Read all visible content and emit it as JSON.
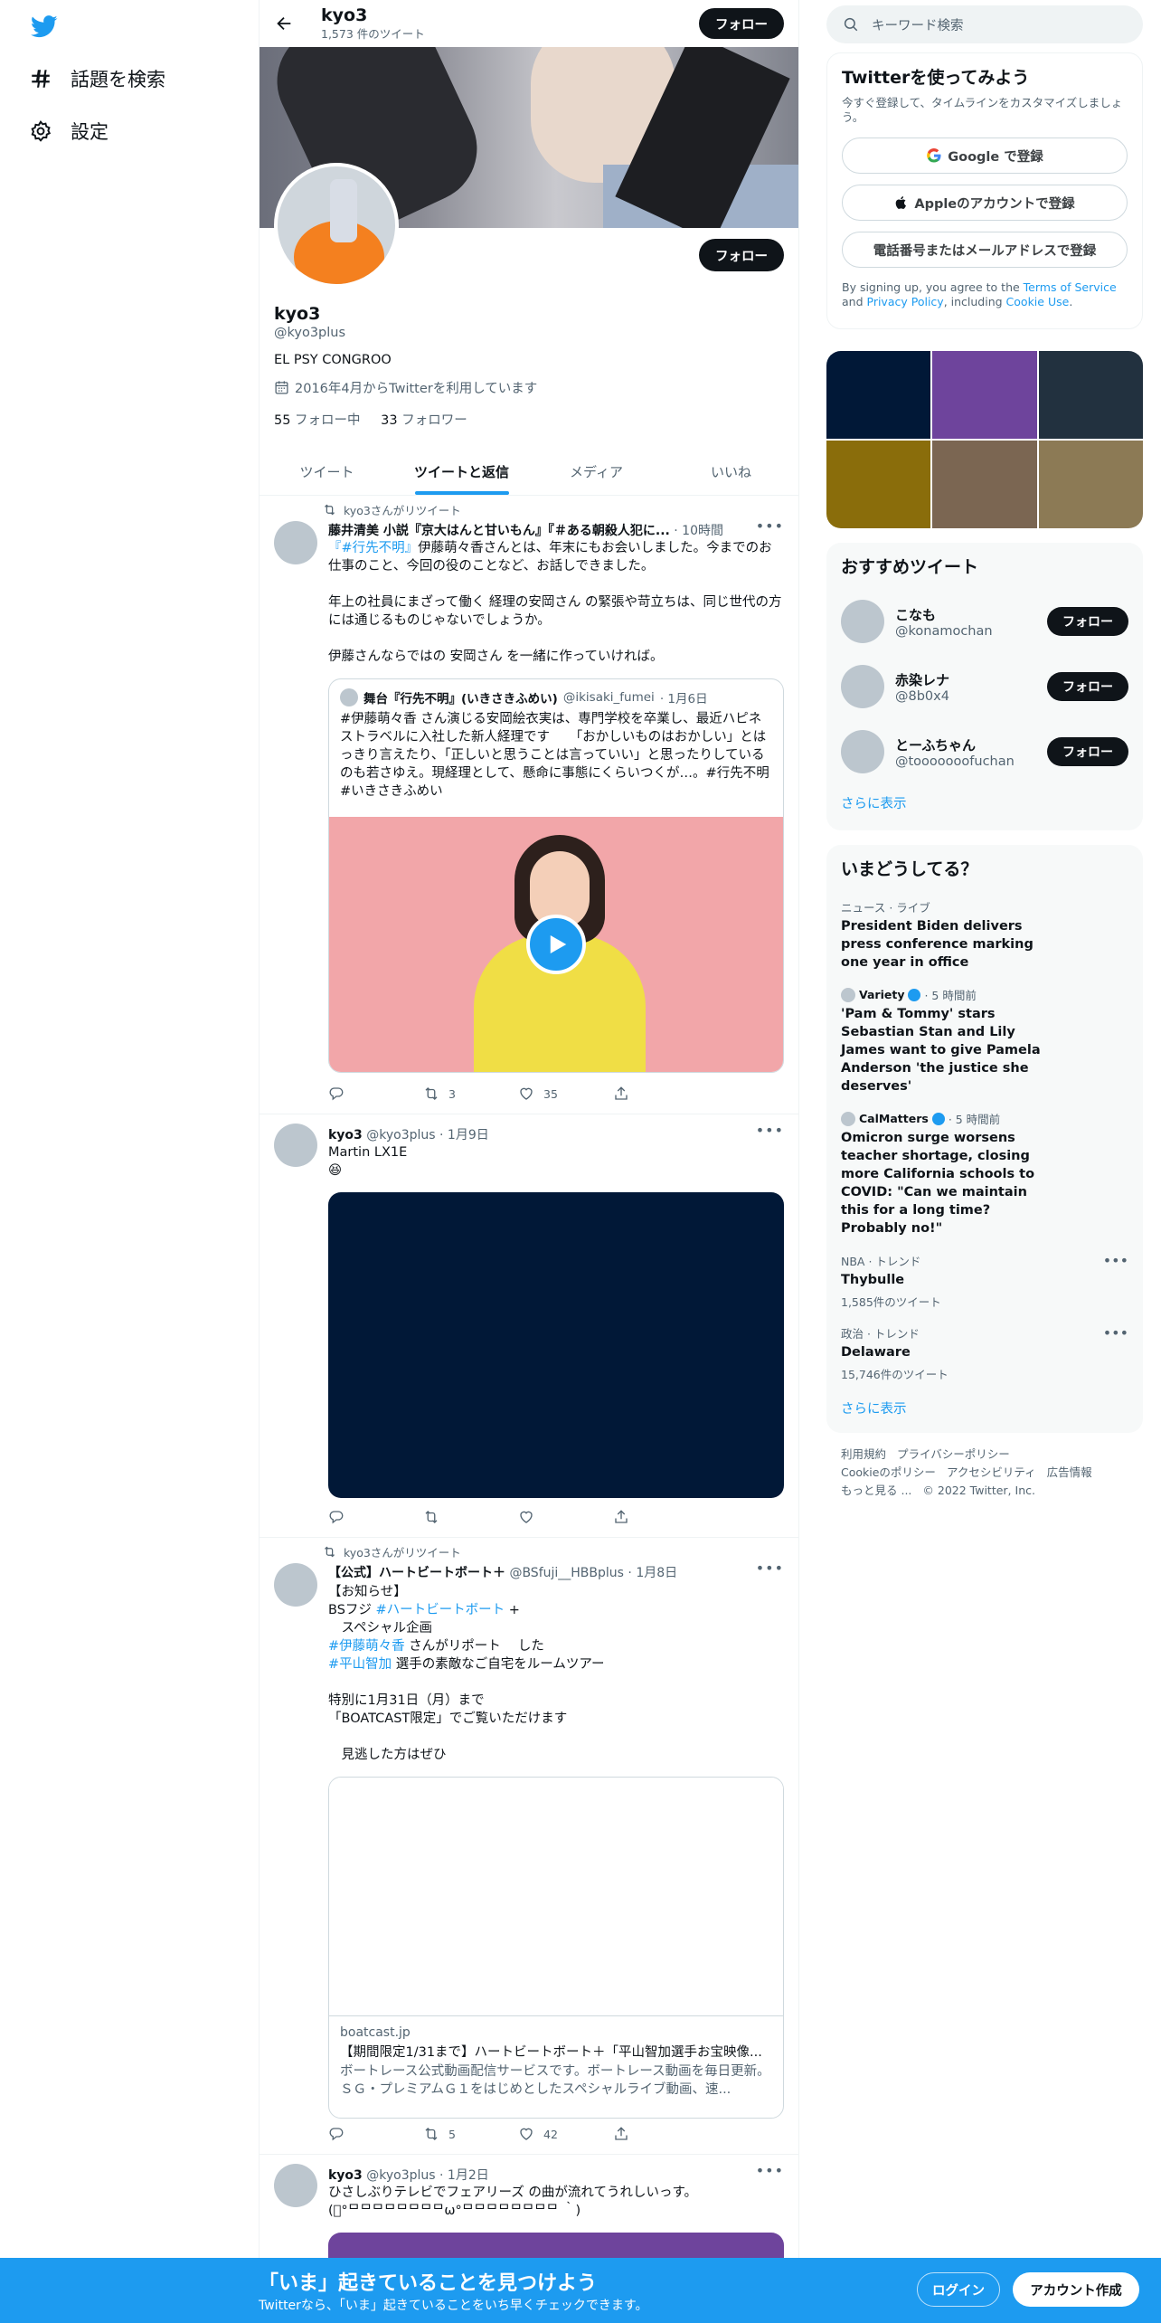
{
  "nav": {
    "explore": "話題を検索",
    "settings": "設定"
  },
  "header": {
    "name": "kyo3",
    "tweet_count": "1,573 件のツイート",
    "follow": "フォロー"
  },
  "profile": {
    "name": "kyo3",
    "handle": "@kyo3plus",
    "bio": "EL PSY CONGROO",
    "joined": "2016年4月からTwitterを利用しています",
    "following_count": "55",
    "following_label": " フォロー中",
    "followers_count": "33",
    "followers_label": " フォロワー",
    "follow": "フォロー"
  },
  "tabs": [
    "ツイート",
    "ツイートと返信",
    "メディア",
    "いいね"
  ],
  "tweets": [
    {
      "retweet_label": "kyo3さんがリツイート",
      "author": "藤井清美 小説『京大はんと甘いもん』『＃ある朝殺人犯に...",
      "meta": " · 10時間",
      "hashtag": "『#行先不明』",
      "text_rest": "伊藤萌々香さんとは、年末にもお会いしました。今までのお仕事のこと、今回の役のことなど、お話しできました。\n\n年上の社員にまざって働く 経理の安岡さん の緊張や苛立ちは、同じ世代の方には通じるものじゃないでしょうか。\n\n伊藤さんならではの 安岡さん を一緒に作っていければ。",
      "quote": {
        "author": "舞台『行先不明』(いきさきふめい)",
        "handle": "@ikisaki_fumei",
        "date": " · 1月6日",
        "text": "#伊藤萌々香 さん演じる安岡絵衣実は、専門学校を卒業し、最近ハピネストラベルに入社した新人経理です　　「おかしいものはおかしい」とはっきり言えたり、「正しいと思うことは言っていい」と思ったりしているのも若さゆえ。現経理として、懸命に事態にくらいつくが…。#行先不明 #いきさきふめい"
      },
      "retweets": "3",
      "likes": "35"
    },
    {
      "author": "kyo3",
      "handle": "@kyo3plus",
      "date": " · 1月9日",
      "text": "Martin LX1E\n😆"
    },
    {
      "retweet_label": "kyo3さんがリツイート",
      "author": "【公式】ハートビートボート＋",
      "handle": "@BSfuji__HBBplus",
      "date": " · 1月8日",
      "text_l1": "【お知らせ】",
      "text_l2a": "BSフジ ",
      "text_l2b": "#ハートビートボート",
      "text_l2c": " +",
      "text_l3": "　スペシャル企画",
      "text_l4a": "#伊藤萌々香",
      "text_l4b": " さんがリポート　 した",
      "text_l5a": "#平山智加",
      "text_l5b": " 選手の素敵なご自宅をルームツアー",
      "text_rest": "\n特別に1月31日（月）まで\n「BOATCAST限定」でご覧いただけます\n\n　見逃した方はぜひ",
      "card": {
        "domain": "boatcast.jp",
        "title": "【期間限定1/31まで】ハートビートボート＋「平山智加選手お宝映像...",
        "desc": "ボートレース公式動画配信サービスです。ボートレース動画を毎日更新。ＳＧ・プレミアムＧ１をはじめとしたスペシャルライブ動画、速..."
      },
      "retweets": "5",
      "likes": "42"
    },
    {
      "author": "kyo3",
      "handle": "@kyo3plus",
      "date": " · 1月2日",
      "text": "ひさしぶりテレビでフェアリーズ の曲が流れてうれしいっす。\n(ﾟ°ᄆᄆᄆᄆᄆᄆᄆᄆω°ᄆᄆᄆᄆᄆᄆᄆᄆ ｀)"
    }
  ],
  "search": {
    "placeholder": "キーワード検索"
  },
  "signup": {
    "title": "Twitterを使ってみよう",
    "subtitle": "今すぐ登録して、タイムラインをカスタマイズしましょう。",
    "google": "Google で登録",
    "apple": "Appleのアカウントで登録",
    "phone": "電話番号またはメールアドレスで登録",
    "legal_1": "By signing up, you agree to the ",
    "terms": "Terms of Service",
    "legal_2": " and ",
    "privacy": "Privacy Policy",
    "legal_3": ", including ",
    "cookie": "Cookie Use",
    "legal_4": "."
  },
  "media_colors": [
    "#011837",
    "#6e449c",
    "#22313f",
    "#8a6d0b",
    "#7b6652",
    "#8c7a55"
  ],
  "recommended": {
    "title": "おすすめツイート",
    "users": [
      {
        "name": "こなも",
        "handle": "@konamochan"
      },
      {
        "name": "赤染レナ",
        "handle": "@8b0x4"
      },
      {
        "name": "とーふちゃん",
        "handle": "@tooooooofuchan"
      }
    ],
    "follow": "フォロー",
    "show_more": "さらに表示"
  },
  "trends": {
    "title": "いまどうしてる？",
    "items": [
      {
        "category": "ニュース · ライブ",
        "title": "President Biden delivers press conference marking one year in office"
      },
      {
        "source": "Variety",
        "time": " · 5 時間前",
        "title": "'Pam & Tommy' stars Sebastian Stan and Lily James want to give Pamela Anderson 'the justice she deserves'"
      },
      {
        "source": "CalMatters",
        "time": " · 5 時間前",
        "title": "Omicron surge worsens teacher shortage, closing more California schools to COVID: \"Can we maintain this for a long time? Probably no!\""
      },
      {
        "category": "NBA · トレンド",
        "title": "Thybulle",
        "count": "1,585件のツイート"
      },
      {
        "category": "政治 · トレンド",
        "title": "Delaware",
        "count": "15,746件のツイート"
      }
    ],
    "show_more": "さらに表示"
  },
  "footer": {
    "terms": "利用規約",
    "privacy": "プライバシーポリシー",
    "cookie": "Cookieのポリシー",
    "accessibility": "アクセシビリティ",
    "ads": "広告情報",
    "more": "もっと見る ...",
    "copyright": "© 2022 Twitter, Inc."
  },
  "bottom": {
    "headline": "「いま」起きていることを見つけよう",
    "sub": "Twitterなら、「いま」起きていることをいち早くチェックできます。",
    "login": "ログイン",
    "signup": "アカウント作成"
  }
}
